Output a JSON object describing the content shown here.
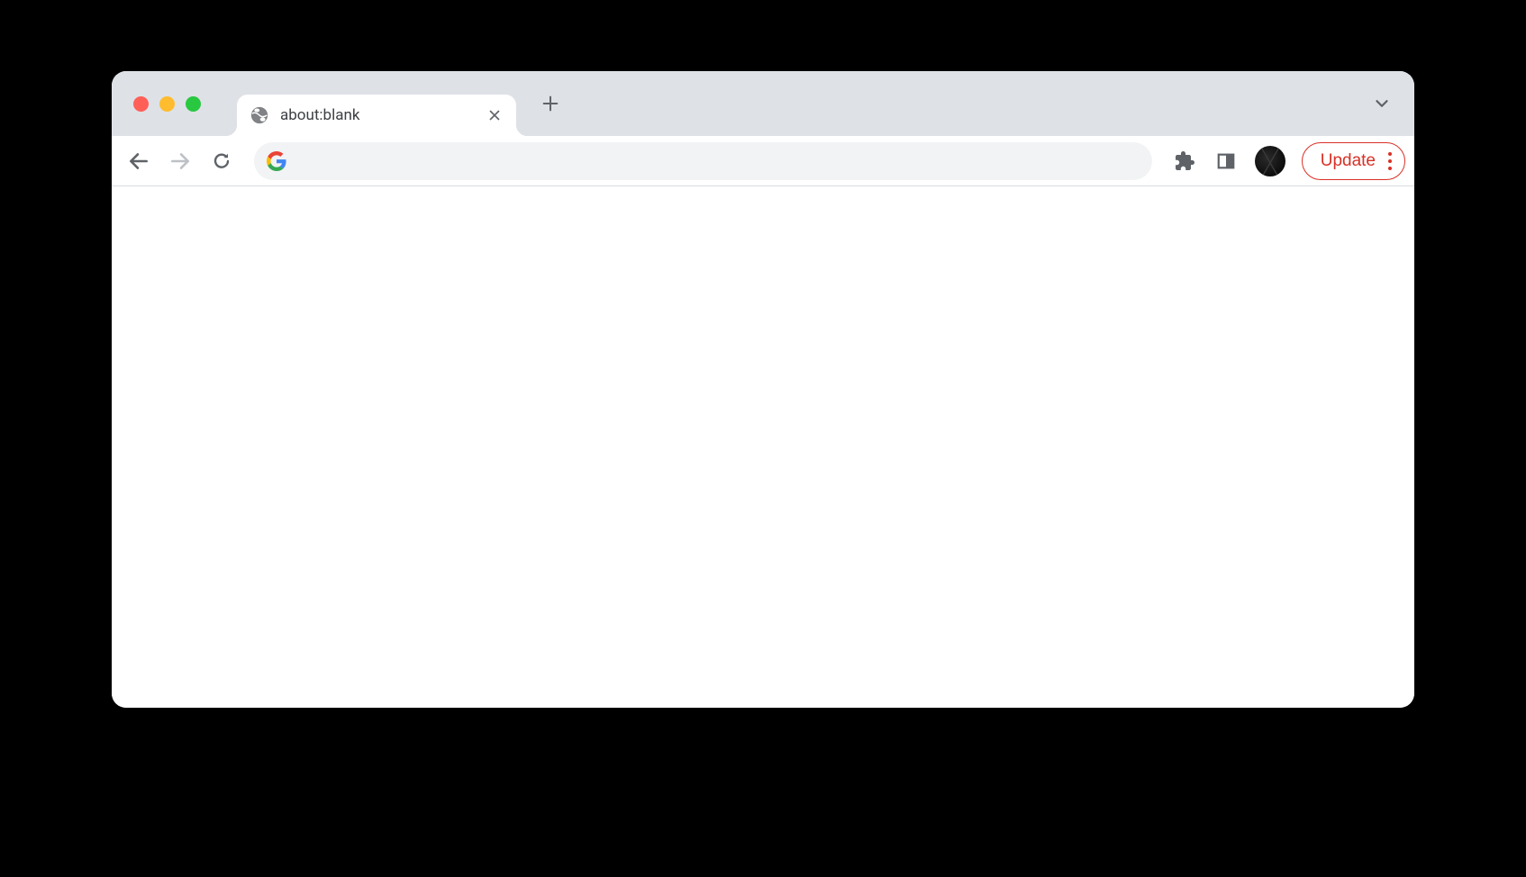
{
  "tab": {
    "title": "about:blank"
  },
  "addressBar": {
    "value": ""
  },
  "toolbar": {
    "update_label": "Update"
  }
}
